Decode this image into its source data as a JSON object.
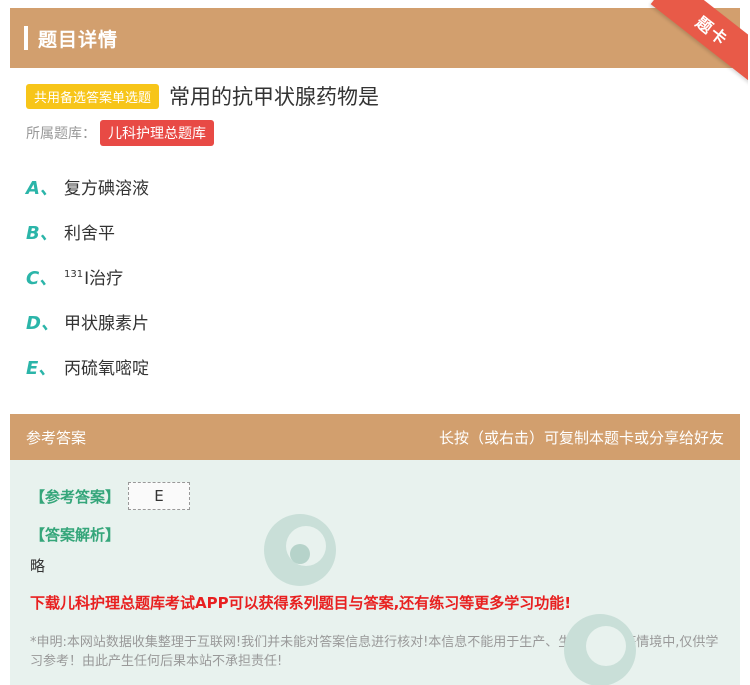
{
  "header": {
    "title": "题目详情",
    "ribbon": "题卡"
  },
  "question": {
    "type_badge": "共用备选答案单选题",
    "text": "常用的抗甲状腺药物是",
    "source_label": "所属题库：",
    "source_tag": "儿科护理总题库"
  },
  "options": [
    {
      "letter": "A、",
      "text": "复方碘溶液"
    },
    {
      "letter": "B、",
      "text": "利舍平"
    },
    {
      "letter": "C、",
      "sup": "131",
      "text": "I治疗"
    },
    {
      "letter": "D、",
      "text": "甲状腺素片"
    },
    {
      "letter": "E、",
      "text": "丙硫氧嘧啶"
    }
  ],
  "answer_section": {
    "title": "参考答案",
    "hint": "长按（或右击）可复制本题卡或分享给好友",
    "answer_label": "【参考答案】",
    "answer_value": "E",
    "analysis_label": "【答案解析】",
    "analysis_text": "略",
    "promo": "下载儿科护理总题库考试APP可以获得系列题目与答案,还有练习等更多学习功能!",
    "disclaimer": "*申明:本网站数据收集整理于互联网!我们并未能对答案信息进行核对!本信息不能用于生产、生活、考试等情境中,仅供学习参考！由此产生任何后果本站不承担责任!"
  },
  "colors": {
    "header_bg": "#d29f6e",
    "ribbon": "#e85a48",
    "option_letter": "#2bb5a9",
    "answer_label": "#35a67a",
    "promo": "#e82020",
    "answer_bg": "#e8f2ee"
  }
}
